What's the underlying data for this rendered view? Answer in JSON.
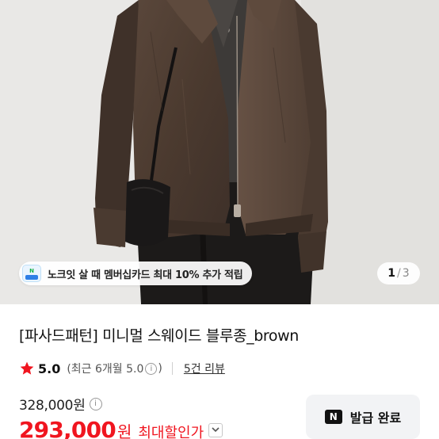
{
  "hero": {
    "promo_icon_text": "N",
    "promo_text": "노크잇 살 때 멤버십카드 최대 10% 추가 적립",
    "pager_current": "1",
    "pager_separator": "/",
    "pager_total": "3"
  },
  "product": {
    "title": "[파사드패턴] 미니멀 스웨이드 블루종_brown",
    "rating": "5.0",
    "recent_rating": "(최근 6개월 5.0",
    "recent_close": ")",
    "review_link": "5건 리뷰",
    "original_price": "328,000원",
    "sale_price": "293,000",
    "sale_unit": "원",
    "sale_label": "최대할인가",
    "coupon_badge": "N",
    "coupon_button": "발급 완료"
  },
  "colors": {
    "accent_red": "#f0151f",
    "star": "#f0151f",
    "jacket_brown": "#4a3a30"
  }
}
